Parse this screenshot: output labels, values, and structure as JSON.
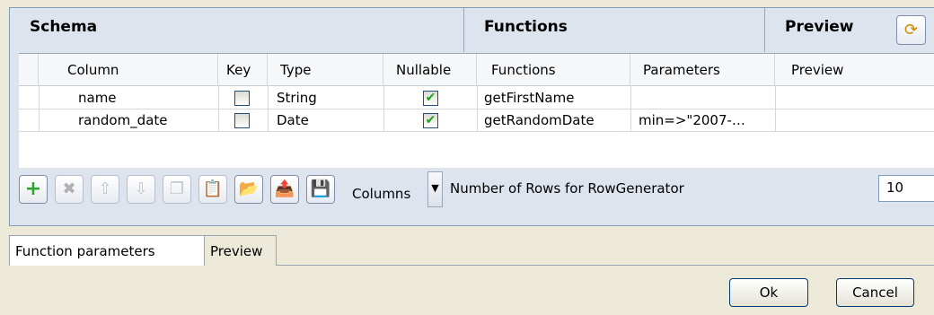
{
  "sections": {
    "schema": "Schema",
    "functions": "Functions",
    "preview": "Preview"
  },
  "columns": {
    "column": "Column",
    "key": "Key",
    "type": "Type",
    "nullable": "Nullable",
    "functions": "Functions",
    "parameters": "Parameters",
    "preview": "Preview"
  },
  "rows": [
    {
      "column": "name",
      "key": false,
      "type": "String",
      "nullable": true,
      "function": "getFirstName",
      "parameters": "",
      "preview": ""
    },
    {
      "column": "random_date",
      "key": false,
      "type": "Date",
      "nullable": true,
      "function": "getRandomDate",
      "parameters": "min=>\"2007-…",
      "preview": ""
    }
  ],
  "toolbar": {
    "columns_label": "Columns",
    "rows_label": "Number of Rows for RowGenerator",
    "rows_value": "10",
    "icons": [
      "add-icon",
      "delete-icon",
      "move-up-icon",
      "move-down-icon",
      "copy-icon",
      "paste-icon",
      "import-icon",
      "export-icon",
      "save-icon"
    ]
  },
  "tabs": [
    "Function parameters",
    "Preview"
  ],
  "buttons": {
    "ok": "Ok",
    "cancel": "Cancel"
  },
  "colors": {
    "checkmark": "#21a121",
    "panel_bg": "#dde4ee",
    "window_bg": "#ece9d8"
  }
}
